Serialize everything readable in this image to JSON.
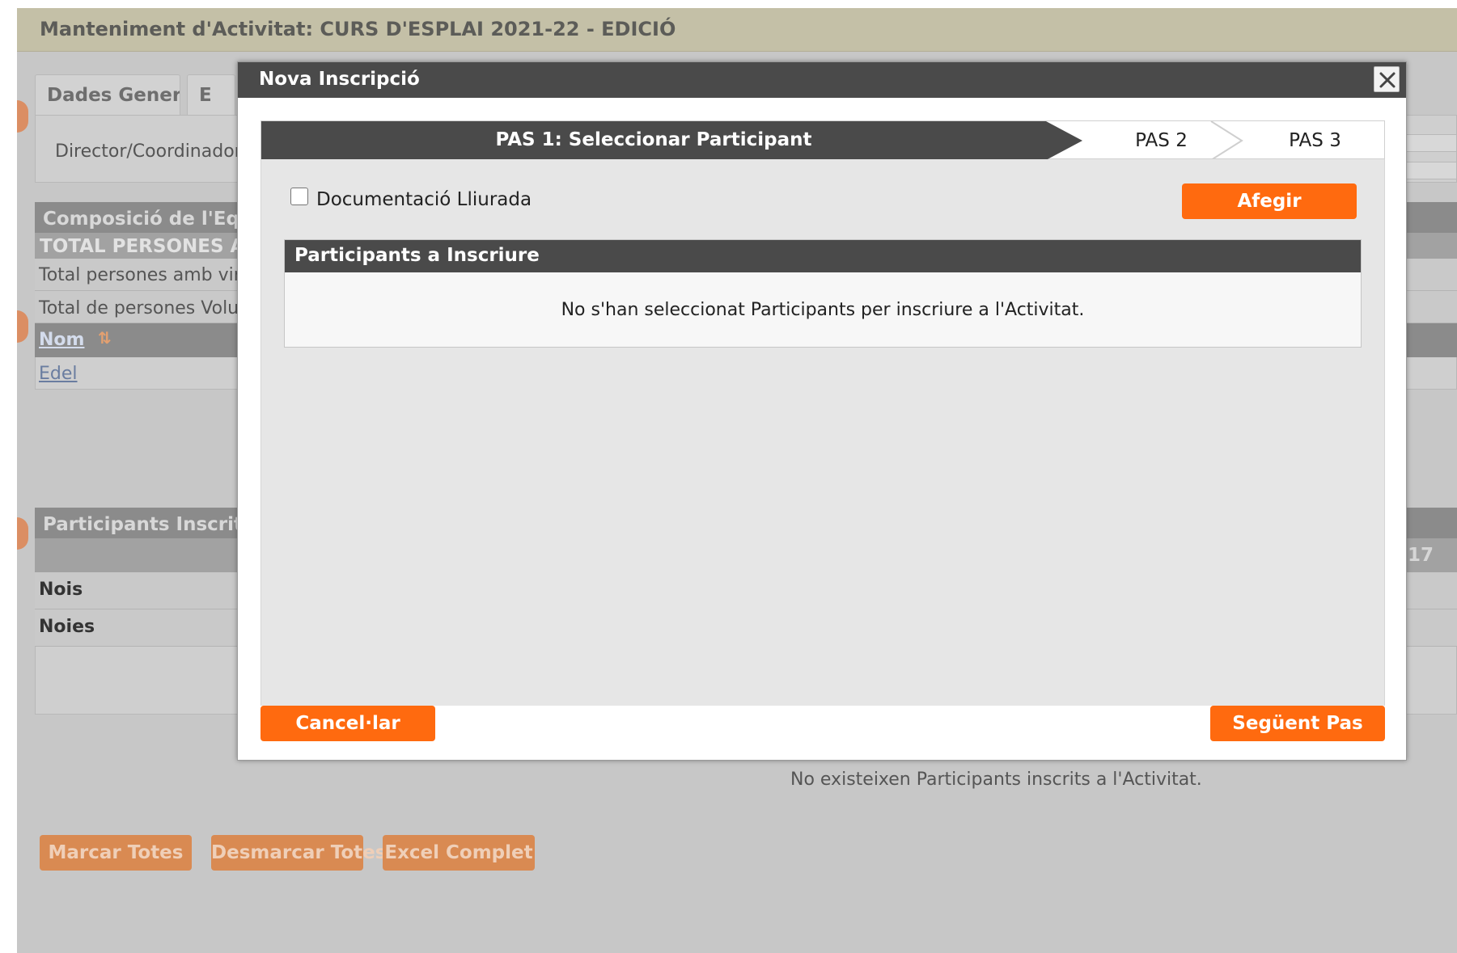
{
  "page": {
    "title": "Manteniment d'Activitat: CURS D'ESPLAI 2021-22 - EDICIÓ",
    "tabs": [
      "Dades Generals",
      "E"
    ],
    "director_label": "Director/Coordinador",
    "team_section_title": "Composició de l'Equi",
    "total_header": "TOTAL PERSONES A I",
    "total_row1": "Total persones amb vinc",
    "total_row2": "Total de persones Volun",
    "name_column": "Nom",
    "member_link": "Edel",
    "participants_section_title": "Participants Inscrits",
    "column_number_fragment": "17",
    "row_boys": "Nois",
    "row_girls": "Noies",
    "no_participants_msg": "No existeixen Participants inscrits a l'Activitat.",
    "buttons": {
      "mark_all": "Marcar Totes",
      "unmark_all": "Desmarcar Totes",
      "excel": "Excel Complet"
    }
  },
  "modal": {
    "title": "Nova Inscripció",
    "steps": {
      "step1": "PAS 1: Seleccionar Participant",
      "step2": "PAS 2",
      "step3": "PAS 3"
    },
    "doc_checkbox_label": "Documentació Lliurada",
    "add_button": "Afegir",
    "panel_title": "Participants a Inscriure",
    "panel_empty_msg": "No s'han seleccionat Participants per inscriure a l'Activitat.",
    "cancel_button": "Cancel·lar",
    "next_button": "Següent Pas"
  },
  "colors": {
    "accent_orange": "#ff6a0f",
    "dark_header": "#4a4a4a",
    "overlay_gray": "#c7c7c7"
  }
}
